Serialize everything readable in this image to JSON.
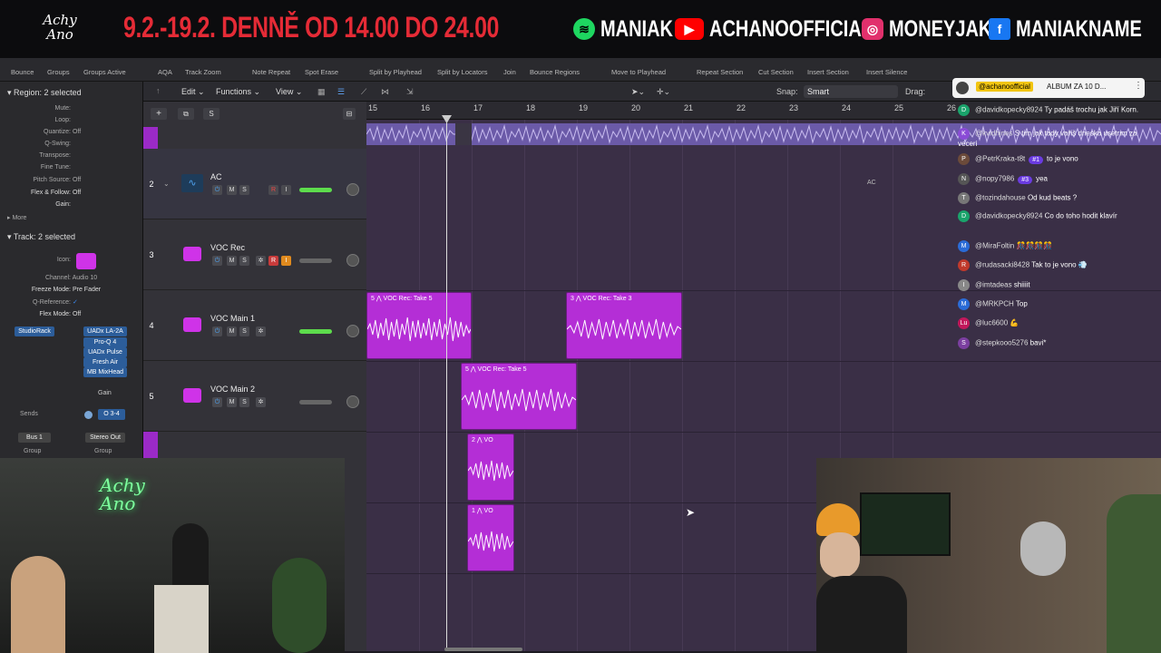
{
  "banner": {
    "logo_text": "Achy Ano",
    "promo_text": "9.2.-19.2. DENNĚ OD 14.00 DO 24.00",
    "socials": [
      {
        "icon": "spotify-icon",
        "label": "MANIAK",
        "color": "#1ed760"
      },
      {
        "icon": "youtube-icon",
        "label": "ACHANOOFFICIAL",
        "color": "#ff0000"
      },
      {
        "icon": "instagram-icon",
        "label": "MONEYJAK",
        "color": "#e1306c"
      },
      {
        "icon": "facebook-icon",
        "label": "MANIAKNAME",
        "color": "#1877f2"
      }
    ]
  },
  "toolbar": {
    "items": [
      "Bounce",
      "Groups",
      "Groups Active",
      "AQA",
      "Track Zoom",
      "Note Repeat",
      "Spot Erase",
      "Split by Playhead",
      "Split by Locators",
      "Join",
      "Bounce Regions",
      "Move to Playhead",
      "Repeat Section",
      "Cut Section",
      "Insert Section",
      "Insert Silence"
    ]
  },
  "inspector": {
    "region_header": "Region: 2 selected",
    "region_params": [
      {
        "label": "Mute:",
        "value": ""
      },
      {
        "label": "Loop:",
        "value": ""
      },
      {
        "label": "Quantize:",
        "value": "Off"
      },
      {
        "label": "Q-Swing:",
        "value": ""
      },
      {
        "label": "Transpose:",
        "value": ""
      },
      {
        "label": "Fine Tune:",
        "value": ""
      },
      {
        "label": "Pitch Source:",
        "value": "Off"
      },
      {
        "label": "Flex & Follow:",
        "value": "Off"
      },
      {
        "label": "Gain:",
        "value": ""
      }
    ],
    "more_label": "More",
    "track_header": "Track: 2 selected",
    "track_params": [
      {
        "label": "Icon:",
        "value": ""
      },
      {
        "label": "Channel:",
        "value": "Audio 10"
      },
      {
        "label": "Freeze Mode:",
        "value": "Pre Fader"
      },
      {
        "label": "Q-Reference:",
        "value": "✓"
      },
      {
        "label": "Flex Mode:",
        "value": "Off"
      }
    ],
    "plugins_left": [
      "StudioRack"
    ],
    "plugins_right": [
      "UADx LA-2A",
      "Pro-Q 4",
      "UADx Pulse",
      "Fresh Air",
      "MB MixHead"
    ],
    "gain_label": "Gain",
    "sends_label": "Sends",
    "send_value": "O 3-4",
    "bus_label": "Bus 1",
    "out_label": "Stereo Out",
    "group_label": "Group"
  },
  "localbar": {
    "edit": "Edit",
    "functions": "Functions",
    "view": "View",
    "snap_label": "Snap:",
    "snap_value": "Smart",
    "drag_label": "Drag:"
  },
  "tracklist": {
    "add_label": "+",
    "s_label": "S",
    "tracks": [
      {
        "num": "2",
        "name": "AC"
      },
      {
        "num": "3",
        "name": "VOC Rec"
      },
      {
        "num": "4",
        "name": "VOC Main 1"
      },
      {
        "num": "5",
        "name": "VOC Main 2"
      }
    ]
  },
  "ruler": {
    "bars": [
      "15",
      "16",
      "17",
      "18",
      "19",
      "20",
      "21",
      "22",
      "23",
      "24",
      "25",
      "26"
    ]
  },
  "regions": {
    "track_ac_label": "AC",
    "r1": "5 ⋀ VOC Rec: Take 5",
    "r2": "3 ⋀ VOC Rec: Take 3",
    "r3": "5 ⋀ VOC Rec: Take 5",
    "r4": "2 ⋀ VO",
    "r5": "1 ⋀ VO"
  },
  "album_popup": {
    "handle": "@achanoofficial",
    "text": "ALBUM ZA 10 D..."
  },
  "chat": [
    {
      "user": "@davidkopecky8924",
      "text": "Ty padáš trochu jak Jiří Korn.",
      "avatar": "D",
      "color": "#1aa36b"
    },
    {
      "user": "@kvidhjnes",
      "text": "S tim jak tady vaříš dneska usetrim za veceri",
      "avatar": "K",
      "color": "#8a4bd6"
    },
    {
      "user": "@PetrKraka-t8t",
      "text": "to je vono",
      "badge": "#1",
      "avatar": "P",
      "color": "#6b4a3a"
    },
    {
      "user": "@nopy7986",
      "text": "yea",
      "badge": "#3",
      "avatar": "N",
      "color": "#555"
    },
    {
      "user": "@tozindahouse",
      "text": "Od kud beats ?",
      "avatar": "T",
      "color": "#777"
    },
    {
      "user": "@davidkopecky8924",
      "text": "Co do toho hodit klavír",
      "avatar": "D",
      "color": "#1aa36b"
    },
    {
      "user": "@MiraFoltin",
      "text": "🎊🎊🎊🎊",
      "avatar": "M",
      "color": "#2a6bd6"
    },
    {
      "user": "@rudasacki8428",
      "text": "Tak to je vono 💨",
      "avatar": "R",
      "color": "#c0392b"
    },
    {
      "user": "@imtadeas",
      "text": "shiiiit",
      "avatar": "I",
      "color": "#888"
    },
    {
      "user": "@MRKPCH",
      "text": "Top",
      "avatar": "M",
      "color": "#2a6bd6"
    },
    {
      "user": "@luc6600",
      "text": "💪",
      "avatar": "Lu",
      "color": "#c2185b"
    },
    {
      "user": "@stepkooo5276",
      "text": "bavi*",
      "avatar": "S",
      "color": "#7b3fa0"
    }
  ]
}
